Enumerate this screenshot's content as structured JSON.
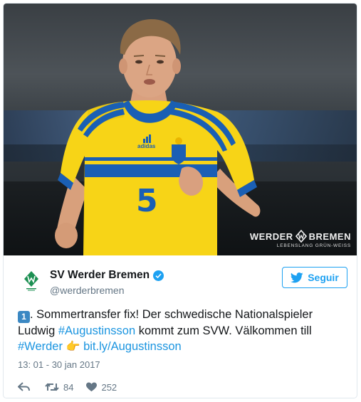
{
  "media": {
    "jersey_number": "5",
    "jersey_brand": "adidas",
    "watermark_title_left": "WERDER",
    "watermark_title_right": "BREMEN",
    "watermark_subtitle": "LEBENSLANG GRÜN-WEISS"
  },
  "account": {
    "name": "SV Werder Bremen",
    "handle": "@werderbremen",
    "verified": true
  },
  "follow_button": {
    "label": "Seguir",
    "icon": "twitter-bird-icon"
  },
  "tweet": {
    "keycap": "1",
    "text_1": ". Sommertransfer fix! Der schwedische Nationalspieler Ludwig ",
    "hashtag_1": "#Augustinsson",
    "text_2": " kommt zum SVW. Välkommen till ",
    "hashtag_2": "#Werder",
    "pointing_emoji": "👉",
    "link": "bit.ly/Augustinsson",
    "timestamp": "13: 01 - 30 jan 2017"
  },
  "actions": {
    "retweets": "84",
    "likes": "252"
  },
  "colors": {
    "twitter_blue": "#1da1f2",
    "link_blue": "#1b95e0",
    "muted_gray": "#657786",
    "werder_green": "#1d9053",
    "jersey_yellow": "#f7d417",
    "jersey_blue": "#1a5fb4"
  }
}
